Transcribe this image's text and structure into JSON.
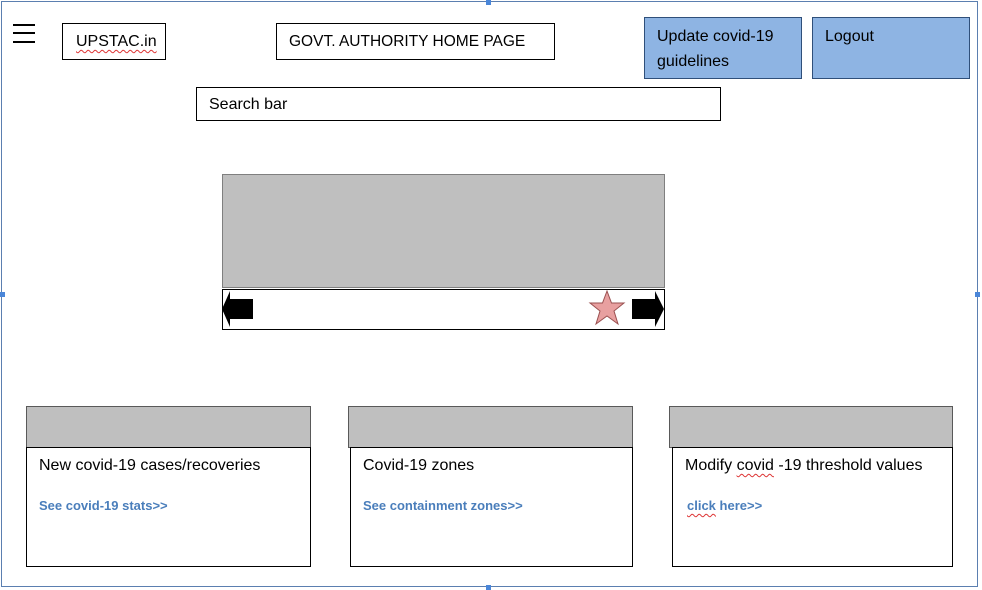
{
  "header": {
    "logo_text": "UPSTAC.in",
    "page_title": "GOVT. AUTHORITY HOME  PAGE",
    "update_button": [
      "Update covid-19",
      "guidelines"
    ],
    "logout_button": "Logout"
  },
  "search": {
    "label": "Search bar"
  },
  "carousel": {
    "icons": [
      "arrow-left-icon",
      "star-icon",
      "arrow-right-icon"
    ],
    "star_color": "#e8a0a0"
  },
  "cards": [
    {
      "title": "New covid-19 cases/recoveries",
      "link": "See covid-19 stats>>"
    },
    {
      "title": "Covid-19 zones",
      "link": "See containment zones>>"
    },
    {
      "title_pre": "Modify ",
      "title_wavy": "covid",
      "title_post": " -19 threshold  values",
      "link_wavy": "click",
      "link_post": " here>>"
    }
  ],
  "colors": {
    "accent_button": "#8eb4e3",
    "placeholder_gray": "#bfbfbf",
    "link": "#4a7ebb"
  }
}
